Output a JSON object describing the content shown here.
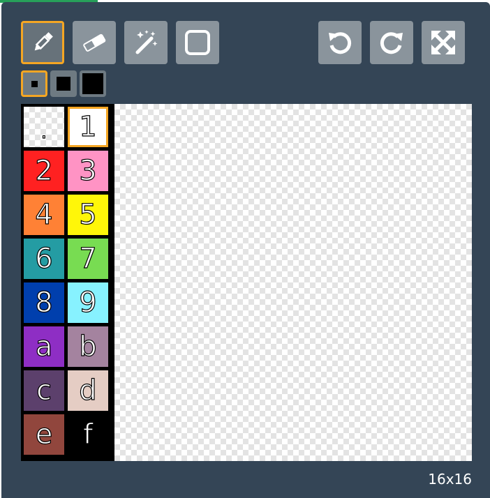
{
  "tools": [
    {
      "name": "pencil",
      "icon": "pencil-icon",
      "selected": true
    },
    {
      "name": "eraser",
      "icon": "eraser-icon",
      "selected": false
    },
    {
      "name": "fill",
      "icon": "magic-wand-icon",
      "selected": false
    },
    {
      "name": "rectangle",
      "icon": "square-icon",
      "selected": false
    }
  ],
  "actions": [
    {
      "name": "undo",
      "icon": "undo-icon"
    },
    {
      "name": "redo",
      "icon": "redo-icon"
    },
    {
      "name": "fullscreen",
      "icon": "expand-icon"
    }
  ],
  "brush_sizes": [
    {
      "size": "small",
      "selected": true
    },
    {
      "size": "medium",
      "selected": false
    },
    {
      "size": "large",
      "selected": false
    }
  ],
  "palette": [
    {
      "label": ".",
      "color": "transparent",
      "selected": false
    },
    {
      "label": "1",
      "color": "#ffffff",
      "selected": true
    },
    {
      "label": "2",
      "color": "#ff2121"
    },
    {
      "label": "3",
      "color": "#ff93c4"
    },
    {
      "label": "4",
      "color": "#ff8135"
    },
    {
      "label": "5",
      "color": "#fff609"
    },
    {
      "label": "6",
      "color": "#249ca3"
    },
    {
      "label": "7",
      "color": "#78dc52"
    },
    {
      "label": "8",
      "color": "#003fad"
    },
    {
      "label": "9",
      "color": "#87f2ff"
    },
    {
      "label": "a",
      "color": "#8e2ec4"
    },
    {
      "label": "b",
      "color": "#a4839f"
    },
    {
      "label": "c",
      "color": "#5c406c"
    },
    {
      "label": "d",
      "color": "#e5cdc4"
    },
    {
      "label": "e",
      "color": "#91463d"
    },
    {
      "label": "f",
      "color": "#000000"
    }
  ],
  "canvas": {
    "size_label": "16x16"
  },
  "colors": {
    "panel_bg": "#344556",
    "accent": "#f5a623",
    "button_bg": "#8a949c"
  }
}
